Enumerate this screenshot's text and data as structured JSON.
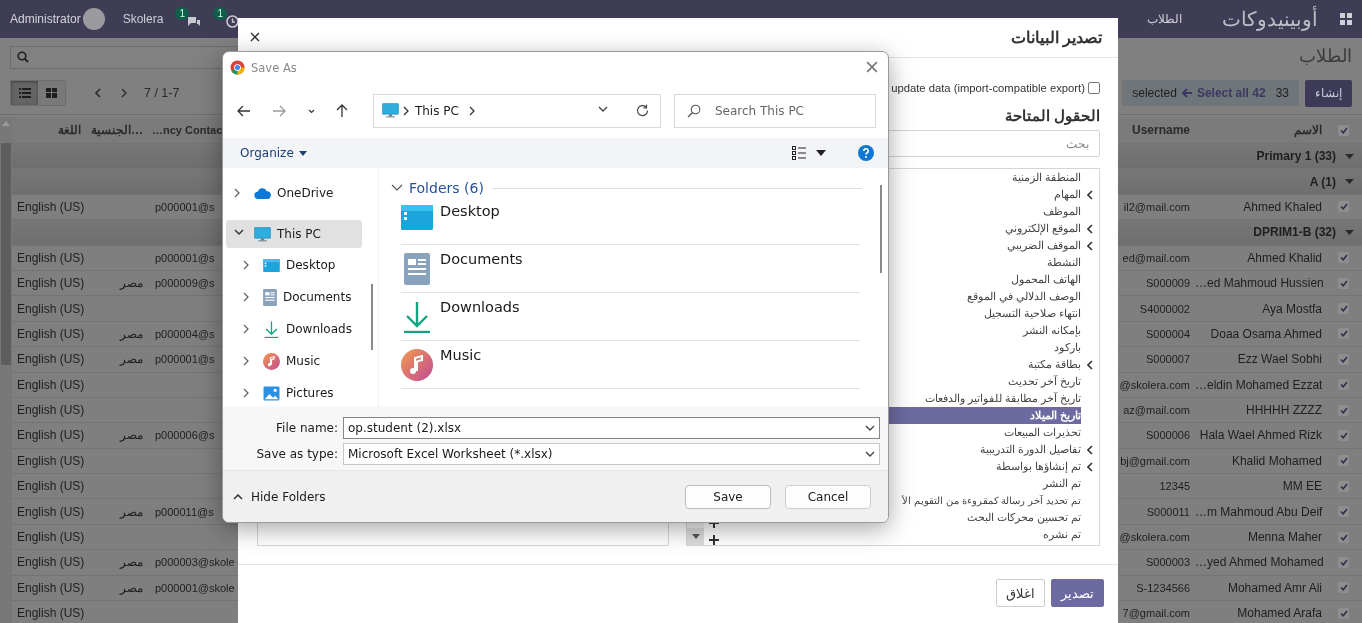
{
  "navbar": {
    "user": "Administrator",
    "company": "Skolera",
    "badges": [
      {
        "kind": "activity",
        "count": "1"
      },
      {
        "kind": "chat",
        "count": "1"
      }
    ],
    "menu": [
      {
        "label": "الطلاب"
      }
    ],
    "app_name": "أوبينيدوكات"
  },
  "control_panel": {
    "breadcrumb": "الطلاب",
    "views": [
      {
        "kind": "list",
        "selected": true
      },
      {
        "kind": "kanban",
        "selected": false
      }
    ],
    "pager": "7 / 1-7",
    "selection": {
      "count": "33",
      "select_all": "Select all 42",
      "label": "selected"
    },
    "create_button": "إنشاء"
  },
  "table": {
    "columns": [
      {
        "label": "الاسم"
      },
      {
        "label": "Username"
      },
      {
        "label": "…ncy Contac"
      },
      {
        "label": "الجنسية…"
      },
      {
        "label": "اللغة"
      }
    ],
    "all_checked": true,
    "rows": [
      {
        "kind": "group",
        "label": "Primary 1 (33)",
        "expanded": true
      },
      {
        "kind": "group",
        "label": "A (1)",
        "expanded": true
      },
      {
        "kind": "record",
        "checked": true,
        "name": "Ahmed Khaled",
        "username": "il2@mail.com",
        "contact": "p000001@s",
        "language": "English (US)"
      },
      {
        "kind": "group",
        "label": "DPRIM1-B (32)",
        "expanded": true
      },
      {
        "kind": "record",
        "checked": true,
        "name": "Ahmed Khalid",
        "username": "ed@mail.com",
        "contact": "p000001@s",
        "language": "English (US)"
      },
      {
        "kind": "record",
        "checked": true,
        "name": "…ed Mahmoud Hussien",
        "username": "S000009",
        "contact": "p000009@s",
        "nationality": "مصر",
        "language": "English (US)"
      },
      {
        "kind": "record",
        "checked": true,
        "name": "Aya Mostfa",
        "username": "S4000002",
        "language": "English (US)"
      },
      {
        "kind": "record",
        "checked": true,
        "name": "Doaa Osama Ahmed",
        "username": "S000004",
        "contact": "p000004@s",
        "nationality": "مصر",
        "language": "English (US)"
      },
      {
        "kind": "record",
        "checked": true,
        "name": "Ezz Wael Sobhi",
        "username": "S000007",
        "contact": "p000001@s",
        "nationality": "مصر",
        "language": "English (US)"
      },
      {
        "kind": "record",
        "checked": true,
        "name": "…eldin Mohamed Ezzat",
        "username": "@skolera.com",
        "language": "English (US)"
      },
      {
        "kind": "record",
        "checked": true,
        "name": "HHHHH ZZZZ",
        "username": "az@mail.com",
        "language": "English (US)"
      },
      {
        "kind": "record",
        "checked": true,
        "name": "Hala Wael Ahmed Rizk",
        "username": "S000006",
        "contact": "p000006@s",
        "nationality": "مصر",
        "language": "English (US)"
      },
      {
        "kind": "record",
        "checked": true,
        "name": "Khalid Mohamed",
        "username": "bj@gmail.com",
        "language": "English (US)"
      },
      {
        "kind": "record",
        "checked": true,
        "name": "MM EE",
        "username": "12345",
        "language": "English (US)"
      },
      {
        "kind": "record",
        "checked": true,
        "name": "…m Mahmoud Abu Deif",
        "username": "S000011",
        "contact": "p000011@s",
        "nationality": "مصر",
        "language": "English (US)"
      },
      {
        "kind": "record",
        "checked": true,
        "name": "Menna Maher",
        "username": "@skolera.com",
        "language": "English (US)"
      },
      {
        "kind": "record",
        "checked": true,
        "name": "…yed Ahmed Mohamed",
        "username": "S000003",
        "contact": "p000003@skole",
        "nationality": "مصر",
        "language": "English (US)"
      },
      {
        "kind": "record",
        "checked": true,
        "name": "Mohamed Amr Ali",
        "username": "S-1234566",
        "contact": "p000001@skole",
        "nationality": "مصر",
        "language": "English (US)"
      },
      {
        "kind": "record",
        "checked": true,
        "name": "Mohamed Arafa",
        "username": "7@gmail.com",
        "language": "English (US)"
      }
    ]
  },
  "export_dialog": {
    "title": "تصدير البيانات",
    "import_compatible": {
      "label": "update data (import-compatible export)",
      "checked": false
    },
    "available_fields_title": "الحقول المتاحة",
    "search": {
      "placeholder": "بحث"
    },
    "fields": [
      {
        "label": "المنطقة الزمنية",
        "expandable": false,
        "selected": false,
        "show_add": false
      },
      {
        "label": "المهام",
        "expandable": true,
        "selected": false,
        "show_add": false
      },
      {
        "label": "الموظف",
        "expandable": false,
        "selected": false,
        "show_add": false
      },
      {
        "label": "الموقع الإلكتروني",
        "expandable": true,
        "selected": false,
        "show_add": false
      },
      {
        "label": "الموقف الضريبي",
        "expandable": true,
        "selected": false,
        "show_add": false
      },
      {
        "label": "النشطة",
        "expandable": false,
        "selected": false,
        "show_add": false
      },
      {
        "label": "الهاتف المحمول",
        "expandable": false,
        "selected": false,
        "show_add": false
      },
      {
        "label": "الوصف الدلالي في الموقع",
        "expandable": false,
        "selected": false,
        "show_add": false
      },
      {
        "label": "انتهاء صلاحية التسجيل",
        "expandable": false,
        "selected": false,
        "show_add": false
      },
      {
        "label": "بإمكانه النشر",
        "expandable": false,
        "selected": false,
        "show_add": false
      },
      {
        "label": "باركود",
        "expandable": false,
        "selected": false,
        "show_add": false
      },
      {
        "label": "بطاقة مكتبة",
        "expandable": true,
        "selected": false,
        "show_add": false
      },
      {
        "label": "تاريخ آخر تحديث",
        "expandable": false,
        "selected": false,
        "show_add": false
      },
      {
        "label": "تاريخ آخر مطابقة للفواتير والدفعات",
        "expandable": false,
        "selected": false,
        "show_add": false
      },
      {
        "label": "تاريخ الميلاد",
        "expandable": false,
        "selected": true,
        "show_add": false
      },
      {
        "label": "تحذيرات المبيعات",
        "expandable": false,
        "selected": false,
        "show_add": false
      },
      {
        "label": "تفاصيل الدورة التدريبية",
        "expandable": true,
        "selected": false,
        "show_add": false
      },
      {
        "label": "تم إنشاؤها بواسطة",
        "expandable": true,
        "selected": false,
        "show_add": false
      },
      {
        "label": "تم النشر",
        "expandable": false,
        "selected": false,
        "show_add": false
      },
      {
        "label": "تم تحديد آخر رسالة كمقروءة من التقويم الأ",
        "expandable": false,
        "selected": false,
        "show_add": false
      },
      {
        "label": "تم تحسين محركات البحث",
        "expandable": false,
        "selected": false,
        "show_add": true
      },
      {
        "label": "تم نشره",
        "expandable": false,
        "selected": false,
        "show_add": true
      }
    ],
    "buttons": [
      {
        "label": "تصدير",
        "kind": "primary"
      },
      {
        "label": "اغلاق",
        "kind": "secondary"
      }
    ]
  },
  "save_dialog": {
    "title": "Save As",
    "address": "This PC",
    "search": {
      "placeholder": "Search This PC"
    },
    "organize": "Organize",
    "nav": [
      {
        "label": "OneDrive",
        "kind": "cloud",
        "expanded": false,
        "selected": false
      },
      {
        "label": "This PC",
        "kind": "pc",
        "expanded": true,
        "selected": true,
        "children": [
          {
            "label": "Desktop",
            "kind": "desktop",
            "expanded": false,
            "selected": false
          },
          {
            "label": "Documents",
            "kind": "documents",
            "expanded": false,
            "selected": false
          },
          {
            "label": "Downloads",
            "kind": "downloads",
            "expanded": false,
            "selected": false
          },
          {
            "label": "Music",
            "kind": "music",
            "expanded": false,
            "selected": false
          },
          {
            "label": "Pictures",
            "kind": "pictures",
            "expanded": false,
            "selected": false
          }
        ]
      }
    ],
    "section": {
      "label": "Folders (6)",
      "expanded": true
    },
    "folders": [
      {
        "label": "Desktop",
        "kind": "desktop"
      },
      {
        "label": "Documents",
        "kind": "documents"
      },
      {
        "label": "Downloads",
        "kind": "downloads"
      },
      {
        "label": "Music",
        "kind": "music"
      }
    ],
    "file_name": {
      "label": "File name:",
      "value": "op.student (2).xlsx"
    },
    "file_type": {
      "label": "Save as type:",
      "value": "Microsoft Excel Worksheet (*.xlsx)"
    },
    "hide_folders": "Hide Folders",
    "buttons": [
      {
        "label": "Cancel",
        "kind": "secondary"
      },
      {
        "label": "Save",
        "kind": "primary"
      }
    ]
  }
}
